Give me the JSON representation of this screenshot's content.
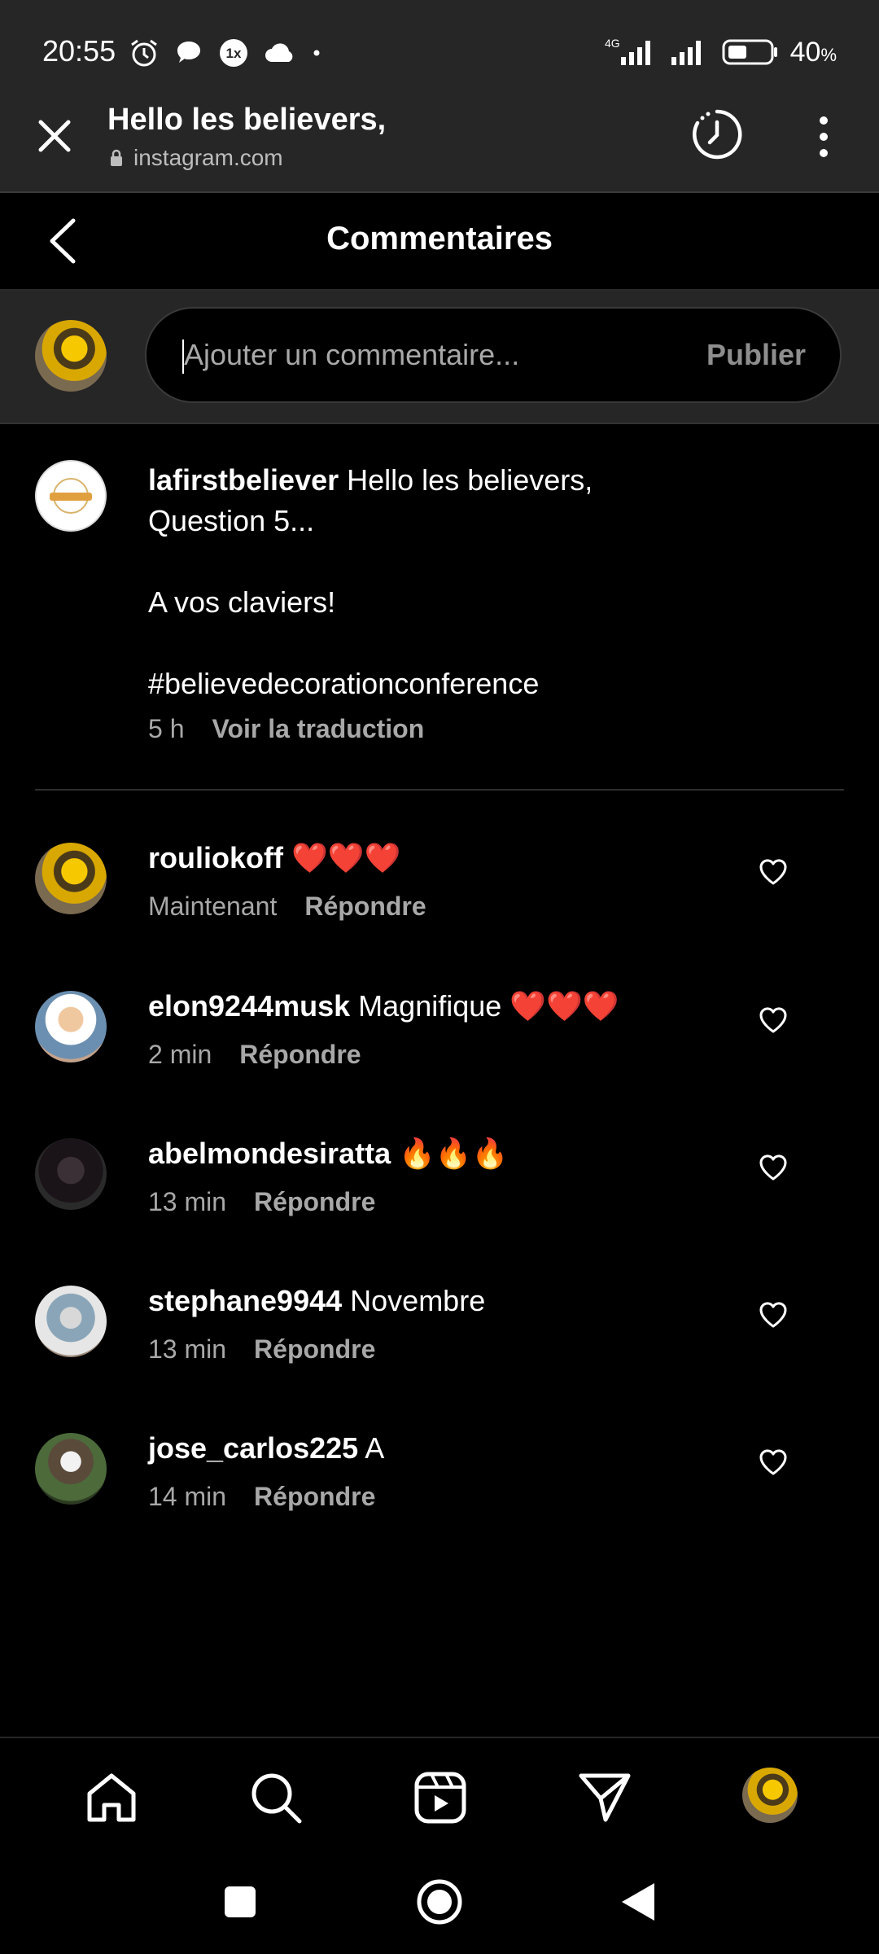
{
  "status_bar": {
    "time": "20:55",
    "network": "4G",
    "battery": "40",
    "battery_unit": "%"
  },
  "browser": {
    "title": "Hello les believers,",
    "url": "instagram.com"
  },
  "comments_header": {
    "title": "Commentaires"
  },
  "composer": {
    "placeholder": "Ajouter un commentaire...",
    "publish_label": "Publier"
  },
  "caption": {
    "username": "lafirstbeliever",
    "text": "Hello les believers,\nQuestion 5...\n\nA vos claviers!\n\n#believedecorationconference",
    "time": "5 h",
    "translate_label": "Voir la traduction"
  },
  "comments": [
    {
      "username": "rouliokoff",
      "text": "❤️❤️❤️",
      "time": "Maintenant",
      "reply_label": "Répondre"
    },
    {
      "username": "elon9244musk",
      "text": "Magnifique ❤️❤️❤️",
      "time": "2 min",
      "reply_label": "Répondre"
    },
    {
      "username": "abelmondesiratta",
      "text": "🔥🔥🔥",
      "time": "13 min",
      "reply_label": "Répondre"
    },
    {
      "username": "stephane9944",
      "text": "Novembre",
      "time": "13 min",
      "reply_label": "Répondre"
    },
    {
      "username": "jose_carlos225",
      "text": "A",
      "time": "14 min",
      "reply_label": "Répondre"
    }
  ],
  "icons": {
    "status_left": [
      "alarm-icon",
      "chat-bubble-icon",
      "1x-app-icon",
      "cloud-icon",
      "dot-icon"
    ],
    "status_right": [
      "signal-4g-icon",
      "signal-icon",
      "battery-icon"
    ],
    "browser": [
      "close-icon",
      "lock-icon",
      "history-icon",
      "more-vertical-icon"
    ],
    "bottom_nav": [
      "home-icon",
      "search-icon",
      "reels-icon",
      "send-icon",
      "profile-avatar"
    ],
    "system_nav": [
      "square-icon",
      "circle-icon",
      "triangle-back-icon"
    ]
  },
  "colors": {
    "background": "#000000",
    "bar": "#262626",
    "secondary_text": "#a8a8a8",
    "publish_disabled": "#8e8e8e"
  }
}
